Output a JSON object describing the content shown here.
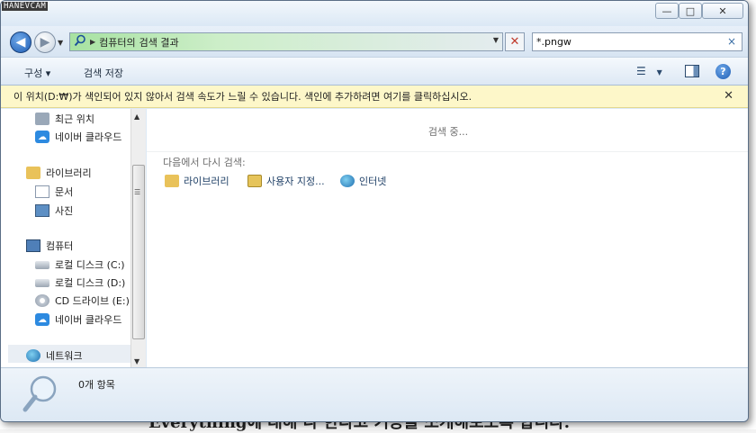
{
  "watermark": "HANEVCAM",
  "background_text": "Everything에 대해 나 한다고 기능을 소개해보도록 합니다.",
  "window": {
    "caption_buttons": {
      "minimize": "—",
      "maximize": "□",
      "close": "✕"
    }
  },
  "address_bar": {
    "back_glyph": "◀",
    "forward_glyph": "▶",
    "crumbs": [
      "컴퓨터의",
      "검색 결과"
    ],
    "stop_glyph": "✕"
  },
  "search": {
    "value": "*.pngw",
    "clear_glyph": "×"
  },
  "toolbar": {
    "organize_label": "구성 ▾",
    "save_search_label": "검색 저장",
    "help_glyph": "?"
  },
  "info_bar": {
    "message": "이 위치(D:₩)가 색인되어 있지 않아서 검색 속도가 느릴 수 있습니다. 색인에 추가하려면 여기를 클릭하십시오.",
    "close_glyph": "✕"
  },
  "nav_pane": {
    "items": [
      {
        "label": "최근 위치",
        "icon": "recent-places-icon"
      },
      {
        "label": "네이버 클라우드",
        "icon": "naver-cloud-icon"
      },
      {
        "label": "라이브러리",
        "icon": "library-icon"
      },
      {
        "label": "문서",
        "icon": "documents-icon"
      },
      {
        "label": "사진",
        "icon": "pictures-icon"
      },
      {
        "label": "컴퓨터",
        "icon": "computer-icon"
      },
      {
        "label": "로컬 디스크 (C:)",
        "icon": "drive-icon"
      },
      {
        "label": "로컬 디스크 (D:)",
        "icon": "drive-icon"
      },
      {
        "label": "CD 드라이브 (E:)",
        "icon": "cd-drive-icon"
      },
      {
        "label": "네이버 클라우드",
        "icon": "naver-cloud-icon"
      },
      {
        "label": "네트워크",
        "icon": "network-icon"
      }
    ]
  },
  "content": {
    "searching_text": "검색 중...",
    "search_again_label": "다음에서 다시 검색:",
    "search_again_options": [
      {
        "label": "라이브러리",
        "icon": "library-icon"
      },
      {
        "label": "사용자 지정...",
        "icon": "custom-folder-icon"
      },
      {
        "label": "인터넷",
        "icon": "internet-icon"
      }
    ]
  },
  "status_bar": {
    "item_count": "0개 항목",
    "icon": "magnifier-icon"
  },
  "colors": {
    "info_bar_bg": "#fdf7c9",
    "chrome_bg": "#dde9f5",
    "address_bar_progress": "#a7e2a1"
  }
}
